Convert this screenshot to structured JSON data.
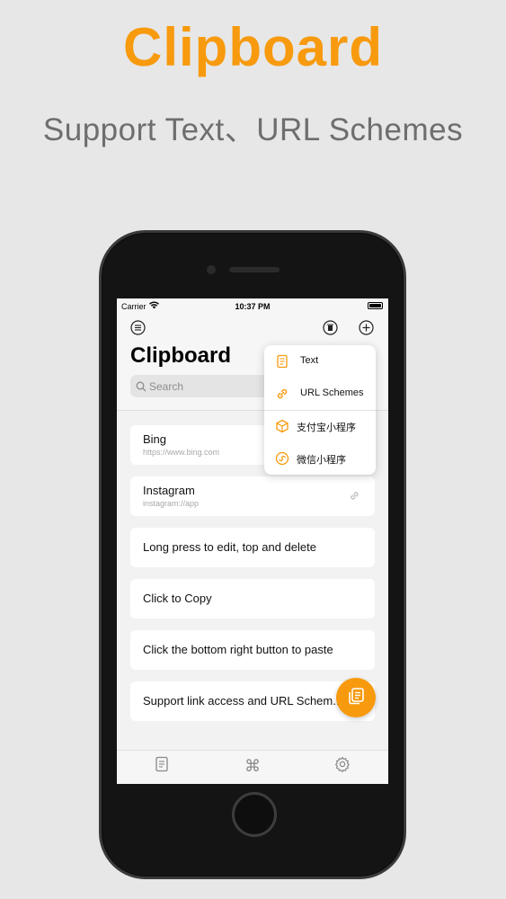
{
  "promo": {
    "title": "Clipboard",
    "subtitle": "Support Text、URL Schemes"
  },
  "status_bar": {
    "carrier": "Carrier",
    "time": "10:37 PM"
  },
  "nav": {
    "title": "Clipboard",
    "search_placeholder": "Search"
  },
  "menu": {
    "items": [
      {
        "label": "Text",
        "icon": "document-icon"
      },
      {
        "label": "URL Schemes",
        "icon": "link-icon"
      },
      {
        "label": "支付宝小程序",
        "icon": "cube-icon"
      },
      {
        "label": "微信小程序",
        "icon": "mini-program-icon"
      }
    ]
  },
  "list": {
    "items": [
      {
        "title": "Bing",
        "subtitle": "https://www.bing.com"
      },
      {
        "title": "Instagram",
        "subtitle": "instagram://app"
      },
      {
        "title": "Long press to edit, top and delete"
      },
      {
        "title": "Click to Copy"
      },
      {
        "title": "Click the bottom right button to paste"
      },
      {
        "title": "Support link access and URL Schem..."
      }
    ]
  },
  "tabs": [
    {
      "icon": "document-icon"
    },
    {
      "icon": "command-icon",
      "glyph": "⌘"
    },
    {
      "icon": "gear-icon"
    }
  ],
  "colors": {
    "accent": "#f79a0e",
    "background": "#e7e7e7",
    "subtitle": "#6e6e6e"
  }
}
